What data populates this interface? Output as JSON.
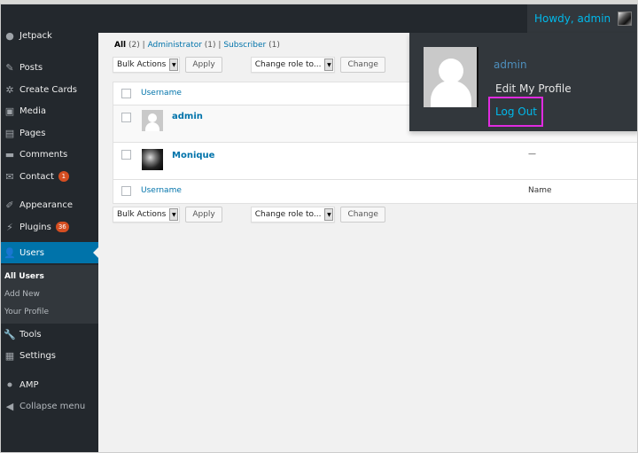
{
  "admin_bar": {
    "greeting": "Howdy, admin",
    "avatar_icon": "user-avatar-photo"
  },
  "account_menu": {
    "display_name": "admin",
    "edit_profile": "Edit My Profile",
    "log_out": "Log Out",
    "highlight_color": "#e02be0"
  },
  "sidebar": {
    "items": [
      {
        "label": "Jetpack",
        "icon": "jetpack-icon"
      },
      {
        "label": "Posts",
        "icon": "pin-icon"
      },
      {
        "label": "Create Cards",
        "icon": "gear-icon"
      },
      {
        "label": "Media",
        "icon": "media-icon"
      },
      {
        "label": "Pages",
        "icon": "pages-icon"
      },
      {
        "label": "Comments",
        "icon": "comment-icon"
      },
      {
        "label": "Contact",
        "icon": "envelope-icon",
        "badge": "1"
      },
      {
        "label": "Appearance",
        "icon": "brush-icon"
      },
      {
        "label": "Plugins",
        "icon": "plug-icon",
        "badge": "36"
      },
      {
        "label": "Users",
        "icon": "user-icon",
        "active": true
      },
      {
        "label": "Tools",
        "icon": "wrench-icon"
      },
      {
        "label": "Settings",
        "icon": "settings-icon"
      },
      {
        "label": "AMP",
        "icon": "amp-icon"
      },
      {
        "label": "Collapse menu",
        "icon": "collapse-icon"
      }
    ],
    "submenu": [
      {
        "label": "All Users",
        "current": true
      },
      {
        "label": "Add New"
      },
      {
        "label": "Your Profile"
      }
    ],
    "active_color": "#0073aa"
  },
  "filters": {
    "all": "All",
    "all_count": "(2)",
    "administrator": "Administrator",
    "administrator_count": "(1)",
    "subscriber": "Subscriber",
    "subscriber_count": "(1)",
    "separator": "|"
  },
  "tablenav": {
    "bulk_actions": "Bulk Actions",
    "apply": "Apply",
    "change_role": "Change role to...",
    "change": "Change"
  },
  "table": {
    "header_username": "Username",
    "footer_username": "Username",
    "footer_name": "Name",
    "rows": [
      {
        "username": "admin",
        "name": ""
      },
      {
        "username": "Monique",
        "name": "—"
      }
    ]
  }
}
